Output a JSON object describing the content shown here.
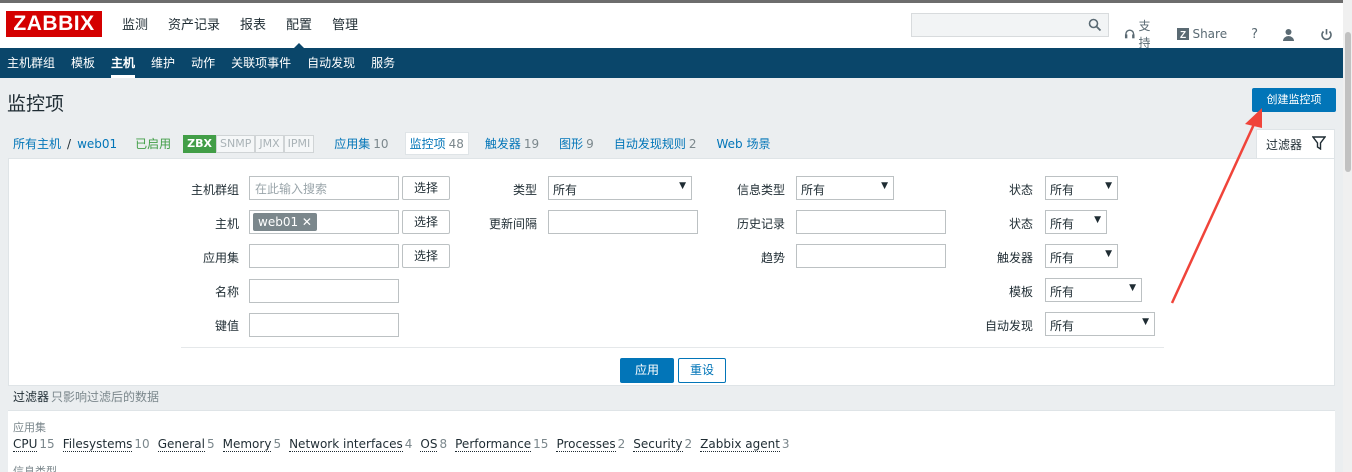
{
  "logo": "ZABBIX",
  "topmenu": [
    {
      "label": "监测"
    },
    {
      "label": "资产记录"
    },
    {
      "label": "报表"
    },
    {
      "label": "配置",
      "active": true
    },
    {
      "label": "管理"
    }
  ],
  "toplinks": {
    "support": "支持",
    "share": "Share",
    "help": "?"
  },
  "submenu": [
    {
      "label": "主机群组"
    },
    {
      "label": "模板"
    },
    {
      "label": "主机",
      "active": true
    },
    {
      "label": "维护"
    },
    {
      "label": "动作"
    },
    {
      "label": "关联项事件"
    },
    {
      "label": "自动发现"
    },
    {
      "label": "服务"
    }
  ],
  "page": {
    "title": "监控项",
    "create_button": "创建监控项"
  },
  "breadcrumb": {
    "all_hosts": "所有主机",
    "sep": "/",
    "host": "web01",
    "status": "已启用",
    "tags": [
      "ZBX",
      "SNMP",
      "JMX",
      "IPMI"
    ],
    "items": [
      {
        "label": "应用集",
        "count": "10"
      },
      {
        "label": "监控项",
        "count": "48"
      },
      {
        "label": "触发器",
        "count": "19"
      },
      {
        "label": "图形",
        "count": "9"
      },
      {
        "label": "自动发现规则",
        "count": "2"
      },
      {
        "label": "Web 场景",
        "count": ""
      }
    ]
  },
  "filter": {
    "tab_label": "过滤器",
    "host_group_label": "主机群组",
    "host_group_placeholder": "在此输入搜索",
    "select_label": "选择",
    "host_label": "主机",
    "host_chip": "web01",
    "app_label": "应用集",
    "name_label": "名称",
    "key_label": "键值",
    "type_label": "类型",
    "type_value": "所有",
    "interval_label": "更新间隔",
    "info_type_label": "信息类型",
    "info_type_value": "所有",
    "history_label": "历史记录",
    "trends_label": "趋势",
    "state_label": "状态",
    "state_value": "所有",
    "status_label": "状态",
    "status_value": "所有",
    "triggers_label": "触发器",
    "triggers_value": "所有",
    "template_label": "模板",
    "template_value": "所有",
    "discovery_label": "自动发现",
    "discovery_value": "所有",
    "apply": "应用",
    "reset": "重设"
  },
  "subfilter": {
    "heading": "过滤器",
    "desc": "只影响过滤后的数据",
    "apps_title": "应用集",
    "apps": [
      {
        "name": "CPU",
        "count": "15"
      },
      {
        "name": "Filesystems",
        "count": "10"
      },
      {
        "name": "General",
        "count": "5"
      },
      {
        "name": "Memory",
        "count": "5"
      },
      {
        "name": "Network interfaces",
        "count": "4"
      },
      {
        "name": "OS",
        "count": "8"
      },
      {
        "name": "Performance",
        "count": "15"
      },
      {
        "name": "Processes",
        "count": "2"
      },
      {
        "name": "Security",
        "count": "2"
      },
      {
        "name": "Zabbix agent",
        "count": "3"
      }
    ],
    "info_type_title": "信息类型"
  },
  "colors": {
    "brand": "#d40000",
    "nav": "#0a466a",
    "primary": "#0275b8",
    "enabled": "#429e47",
    "annotation_arrow": "#f0443a"
  }
}
